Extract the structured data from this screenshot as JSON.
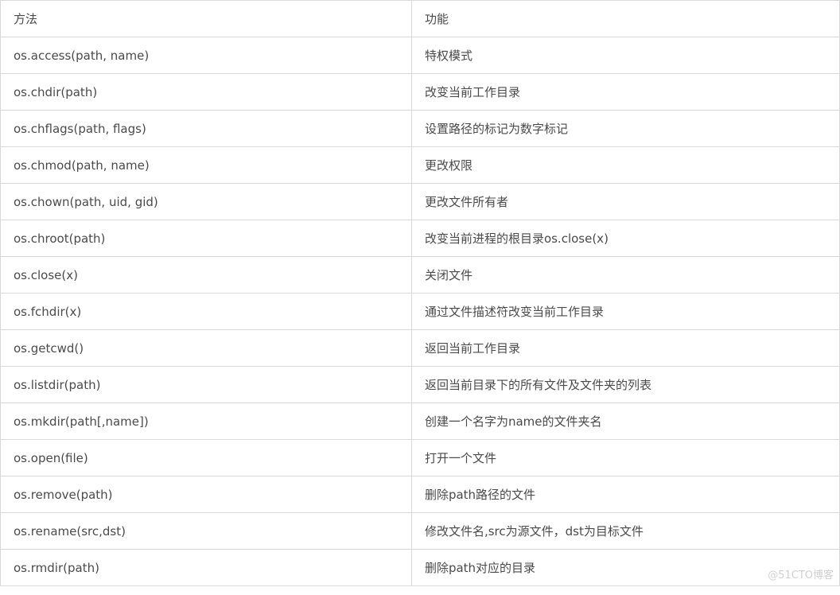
{
  "table": {
    "headers": {
      "method": "方法",
      "function": "功能"
    },
    "rows": [
      {
        "method": "os.access(path, name)",
        "function": "特权模式"
      },
      {
        "method": "os.chdir(path)",
        "function": "改变当前工作目录"
      },
      {
        "method": "os.chflags(path, flags)",
        "function": "设置路径的标记为数字标记"
      },
      {
        "method": "os.chmod(path, name)",
        "function": "更改权限"
      },
      {
        "method": "os.chown(path, uid, gid)",
        "function": "更改文件所有者"
      },
      {
        "method": "os.chroot(path)",
        "function": "改变当前进程的根目录os.close(x)"
      },
      {
        "method": "os.close(x)",
        "function": "关闭文件"
      },
      {
        "method": "os.fchdir(x)",
        "function": "通过文件描述符改变当前工作目录"
      },
      {
        "method": "os.getcwd()",
        "function": "返回当前工作目录"
      },
      {
        "method": "os.listdir(path)",
        "function": "返回当前目录下的所有文件及文件夹的列表"
      },
      {
        "method": "os.mkdir(path[,name])",
        "function": "创建一个名字为name的文件夹名"
      },
      {
        "method": "os.open(file)",
        "function": "打开一个文件"
      },
      {
        "method": "os.remove(path)",
        "function": "删除path路径的文件"
      },
      {
        "method": "os.rename(src,dst)",
        "function": "修改文件名,src为源文件，dst为目标文件"
      },
      {
        "method": "os.rmdir(path)",
        "function": "删除path对应的目录"
      }
    ]
  },
  "watermark": "@51CTO博客"
}
